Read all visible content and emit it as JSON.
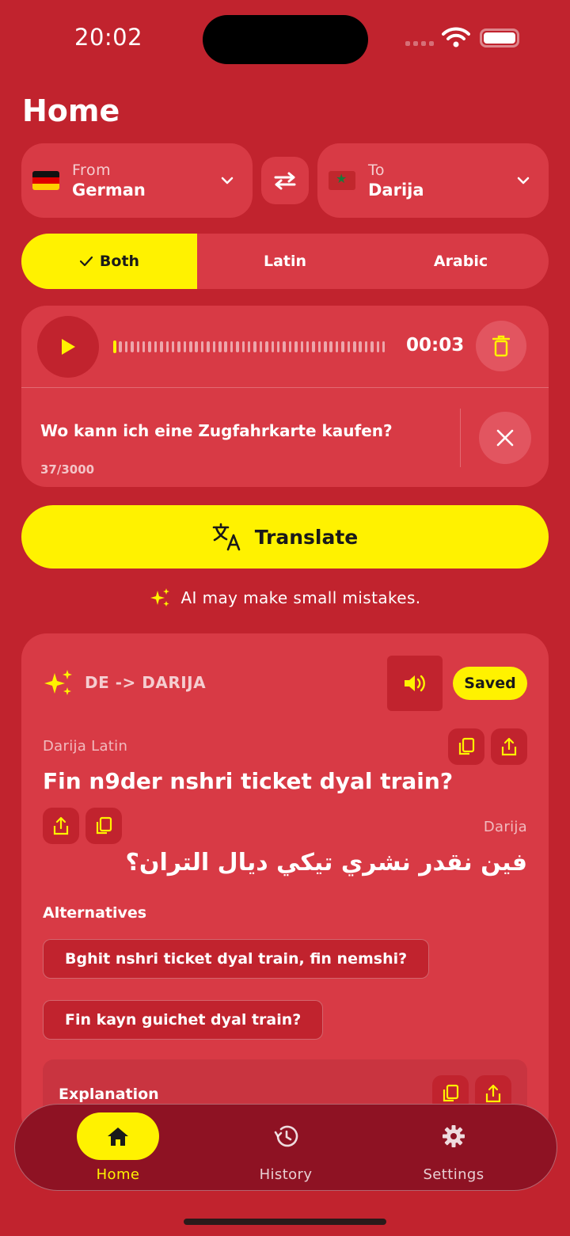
{
  "status": {
    "time": "20:02"
  },
  "header": {
    "title": "Home"
  },
  "languages": {
    "from": {
      "label": "From",
      "value": "German",
      "flag": "germany-flag"
    },
    "to": {
      "label": "To",
      "value": "Darija",
      "flag": "morocco-flag"
    }
  },
  "script_toggle": {
    "options": [
      "Both",
      "Latin",
      "Arabic"
    ],
    "selected": "Both"
  },
  "input": {
    "audio_time": "00:03",
    "text": "Wo kann ich eine Zugfahrkarte kaufen?",
    "counter": "37/3000"
  },
  "translate_button": {
    "label": "Translate"
  },
  "disclaimer": "AI may make small mistakes.",
  "result": {
    "pair": "DE -> DARIJA",
    "saved_label": "Saved",
    "latin_label": "Darija Latin",
    "latin_text": "Fin n9der nshri ticket dyal train?",
    "arabic_label": "Darija",
    "arabic_text": "فين نقدر نشري تيكي ديال التران؟",
    "alternatives_title": "Alternatives",
    "alternatives": [
      "Bghit nshri ticket dyal train, fin nemshi?",
      "Fin kayn guichet dyal train?"
    ],
    "explanation_title": "Explanation"
  },
  "nav": {
    "items": [
      "Home",
      "History",
      "Settings"
    ],
    "active": "Home"
  },
  "colors": {
    "background": "#c1232e",
    "card": "#d83a45",
    "accent": "#fff200",
    "nav": "#8e1223"
  }
}
